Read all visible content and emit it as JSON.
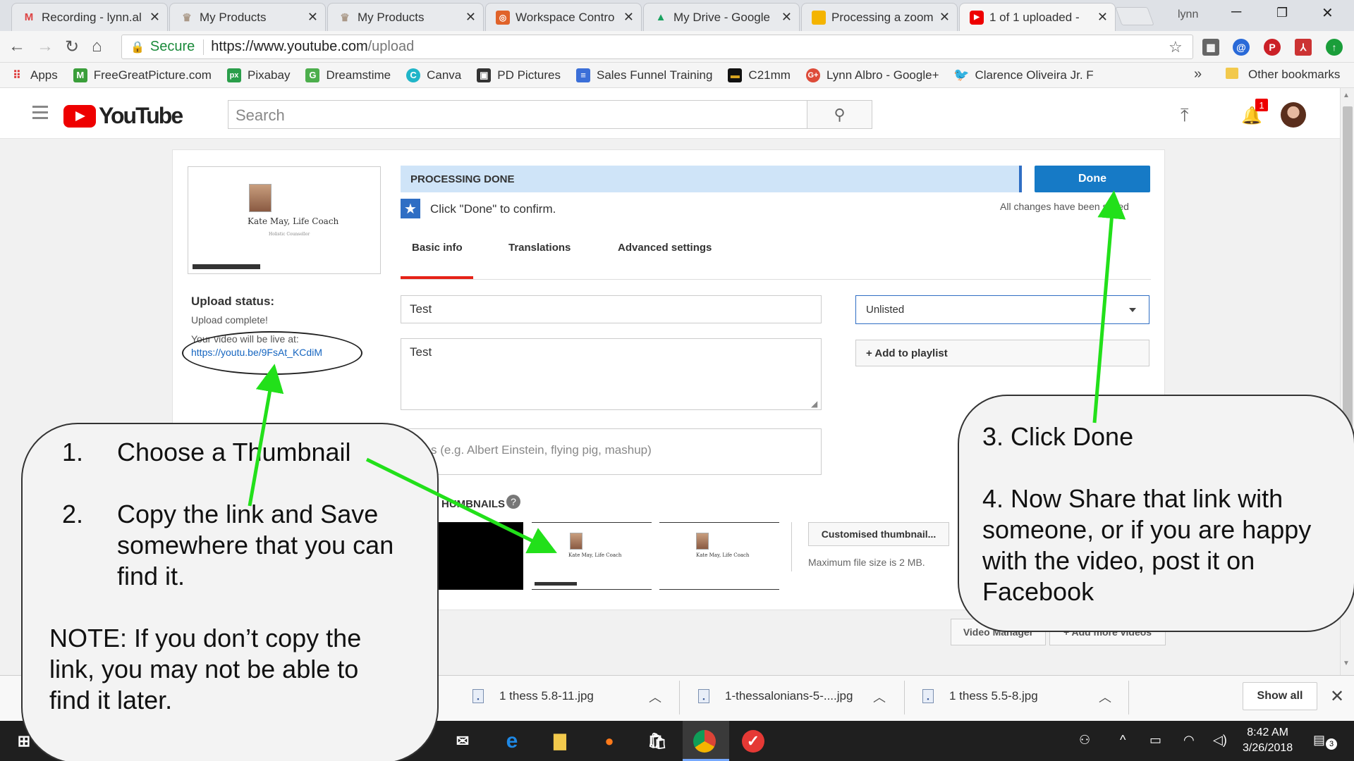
{
  "browser": {
    "tabs": [
      {
        "icon": "gmail-icon",
        "title": "Recording - lynn.al"
      },
      {
        "icon": "product-icon",
        "title": "My Products"
      },
      {
        "icon": "product-icon",
        "title": "My Products"
      },
      {
        "icon": "workspace-icon",
        "title": "Workspace Contro"
      },
      {
        "icon": "google-drive-icon",
        "title": "My Drive - Google"
      },
      {
        "icon": "slides-icon",
        "title": "Processing a zoom"
      },
      {
        "icon": "youtube-icon",
        "title": "1 of 1 uploaded -"
      }
    ],
    "active_tab": 6,
    "profile_name": "lynn",
    "secure_label": "Secure",
    "url_domain": "https://www.youtube.com",
    "url_path": "/upload",
    "bookmarks": [
      {
        "icon": "apps-icon",
        "label": "Apps"
      },
      {
        "icon": "freegreat-icon",
        "label": "FreeGreatPicture.com"
      },
      {
        "icon": "pixabay-icon",
        "label": "Pixabay"
      },
      {
        "icon": "dreamstime-icon",
        "label": "Dreamstime"
      },
      {
        "icon": "canva-icon",
        "label": "Canva"
      },
      {
        "icon": "pd-pictures-icon",
        "label": "PD Pictures"
      },
      {
        "icon": "document-icon",
        "label": "Sales Funnel Training"
      },
      {
        "icon": "c21mm-icon",
        "label": "C21mm"
      },
      {
        "icon": "google-plus-icon",
        "label": "Lynn Albro - Google+"
      },
      {
        "icon": "twitter-icon",
        "label": "Clarence Oliveira Jr. F"
      }
    ],
    "overflow_label": "»",
    "other_bookmarks": "Other bookmarks"
  },
  "youtube": {
    "logo_text": "YouTube",
    "search_placeholder": "Search",
    "notification_count": "1"
  },
  "upload": {
    "thumb_caption": "Kate May, Life Coach",
    "thumb_subcaption": "Holistic Counsellor",
    "status_title": "Upload status:",
    "status_text": "Upload complete!",
    "live_label": "Your video will be live at:",
    "video_link": "https://youtu.be/9FsAt_KCdiM",
    "processing_label": "PROCESSING DONE",
    "done_label": "Done",
    "confirm_msg": "Click \"Done\" to confirm.",
    "saved_msg": "All changes have been saved",
    "tabs": [
      "Basic info",
      "Translations",
      "Advanced settings"
    ],
    "title_value": "Test",
    "description_value": "Test",
    "tags_placeholder": "Tags (e.g. Albert Einstein, flying pig, mashup)",
    "tags_visible": "s (e.g. Albert Einstein, flying pig, mashup)",
    "privacy_value": "Unlisted",
    "playlist_label": "+ Add to playlist",
    "thumbnails_label": "HUMBNAILS",
    "help_glyph": "?",
    "custom_thumb_label": "Customised thumbnail...",
    "max_size_label": "Maximum file size is 2 MB.",
    "video_manager_label": "Video Manager",
    "add_more_label": "+ Add more videos"
  },
  "downloads": {
    "items": [
      "1 thess 5.8-11.jpg",
      "1-thessalonians-5-....jpg",
      "1 thess 5.5-8.jpg"
    ],
    "show_all": "Show all"
  },
  "taskbar": {
    "time": "8:42 AM",
    "date": "3/26/2018",
    "notif_count": "3"
  },
  "callouts": {
    "left": {
      "item1_num": "1.",
      "item1_text": "Choose a Thumbnail",
      "item2_num": "2.",
      "item2_line1": "Copy the link and Save",
      "item2_line2": "somewhere that you can",
      "item2_line3": "find it.",
      "note_line1": "NOTE: If you don’t copy the",
      "note_line2": "link, you may not be able to",
      "note_line3": "find it later."
    },
    "right": {
      "step3": "3. Click Done",
      "step4_line1": "4. Now Share that link with",
      "step4_line2": "someone, or if you are happy",
      "step4_line3": "with the video, post it on",
      "step4_line4": "Facebook"
    }
  },
  "colors": {
    "arrow": "#22e01a",
    "youtube_red": "#e62117",
    "done_blue": "#167ac6",
    "processing_bg": "#cfe4f8"
  }
}
